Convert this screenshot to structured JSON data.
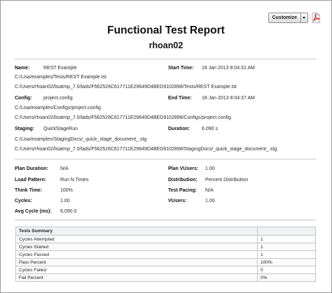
{
  "toolbar": {
    "customize_label": "Customize",
    "pdf_icon": "pdf-icon",
    "pdf_color": "#d41f1f"
  },
  "report": {
    "title": "Functional Test Report",
    "subtitle": "rhoan02"
  },
  "info": {
    "name_label": "Name:",
    "name_value": "REST Example",
    "start_label": "Start Time:",
    "start_value": "18 Jan 2013 8:04:31 AM",
    "path1": "C:/Lisa/examples/Tests/REST Example.tst",
    "path2": "C:/Users/rhoan02/lisatmp_7.0/lads/F562526C617711E29649D4BED9102898/Tests/REST Example.tst",
    "config_label": "Config:",
    "config_value": "project.config",
    "end_label": "End Time:",
    "end_value": "18 Jan 2013 8:04:37 AM",
    "path3": "C:/Lisa/examples/Configs/project.config",
    "path4": "C:/Users/rhoan02/lisatmp_7.0/lads/F562526C617711E29649D4BED9102898/Configs/project.config",
    "staging_label": "Staging:",
    "staging_value": "QuickStageRun",
    "duration_label": "Duration:",
    "duration_value": "6.090 s",
    "path5": "C:/Lisa/examples/StagingDocs/_quick_stage_document_.stg",
    "path6": "C:/Users/rhoan02/lisatmp_7.0/lads/F562526C617711E29649D4BED9102898/StagingDocs/_quick_stage_document_.stg"
  },
  "plan": {
    "plan_duration_label": "Plan Duration:",
    "plan_duration_value": "N/A",
    "plan_vusers_label": "Plan VUsers:",
    "plan_vusers_value": "1.00",
    "load_pattern_label": "Load Pattern:",
    "load_pattern_value": "Run N Times",
    "distribution_label": "Distribution:",
    "distribution_value": "Percent Distribution",
    "think_label": "Think Time:",
    "think_value": "100%",
    "pacing_label": "Test Pacing:",
    "pacing_value": "N/A",
    "cycles_label": "Cycles:",
    "cycles_value": "1.00",
    "vusers_label": "VUsers:",
    "vusers_value": "1.00",
    "avg_label": "Avg Cycle (ms):",
    "avg_value": "6,090.0"
  },
  "summary": {
    "header": "Tests Summary",
    "rows": [
      {
        "label": "Cycles Attempted",
        "value": "1"
      },
      {
        "label": "Cycles Started",
        "value": "1"
      },
      {
        "label": "Cycles Passed",
        "value": "1"
      },
      {
        "label": "Pass Percent",
        "value": "100%"
      },
      {
        "label": "Cycles Failed",
        "value": "0"
      },
      {
        "label": "Fail Percent",
        "value": "0%"
      }
    ]
  }
}
